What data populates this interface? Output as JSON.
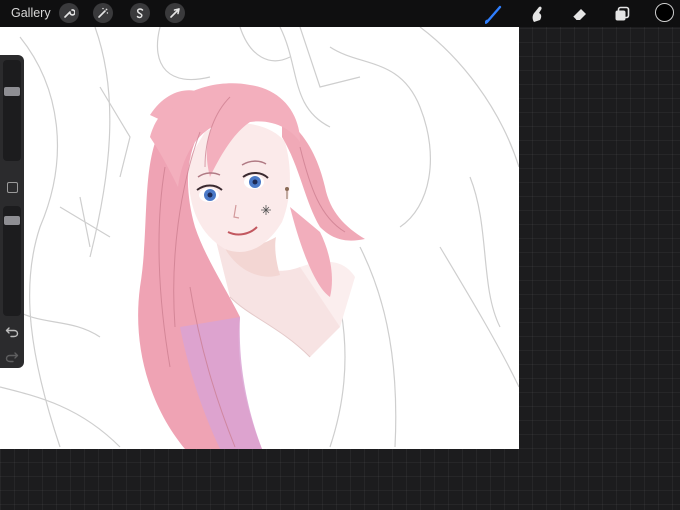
{
  "toolbar": {
    "gallery_label": "Gallery",
    "left_tools": [
      "wrench-icon",
      "magic-wand-icon",
      "selection-icon",
      "transform-icon"
    ],
    "right_tools": [
      "brush-icon",
      "smudge-icon",
      "eraser-icon",
      "layers-icon"
    ],
    "active_tool": "brush-icon",
    "current_color": "#000000"
  },
  "sidebar": {
    "brush_size_level": 0.72,
    "opacity_level": 0.92
  },
  "colors": {
    "accent": "#2f7fff",
    "hair": "#f2a7b5",
    "background": "#1c1c1e"
  }
}
